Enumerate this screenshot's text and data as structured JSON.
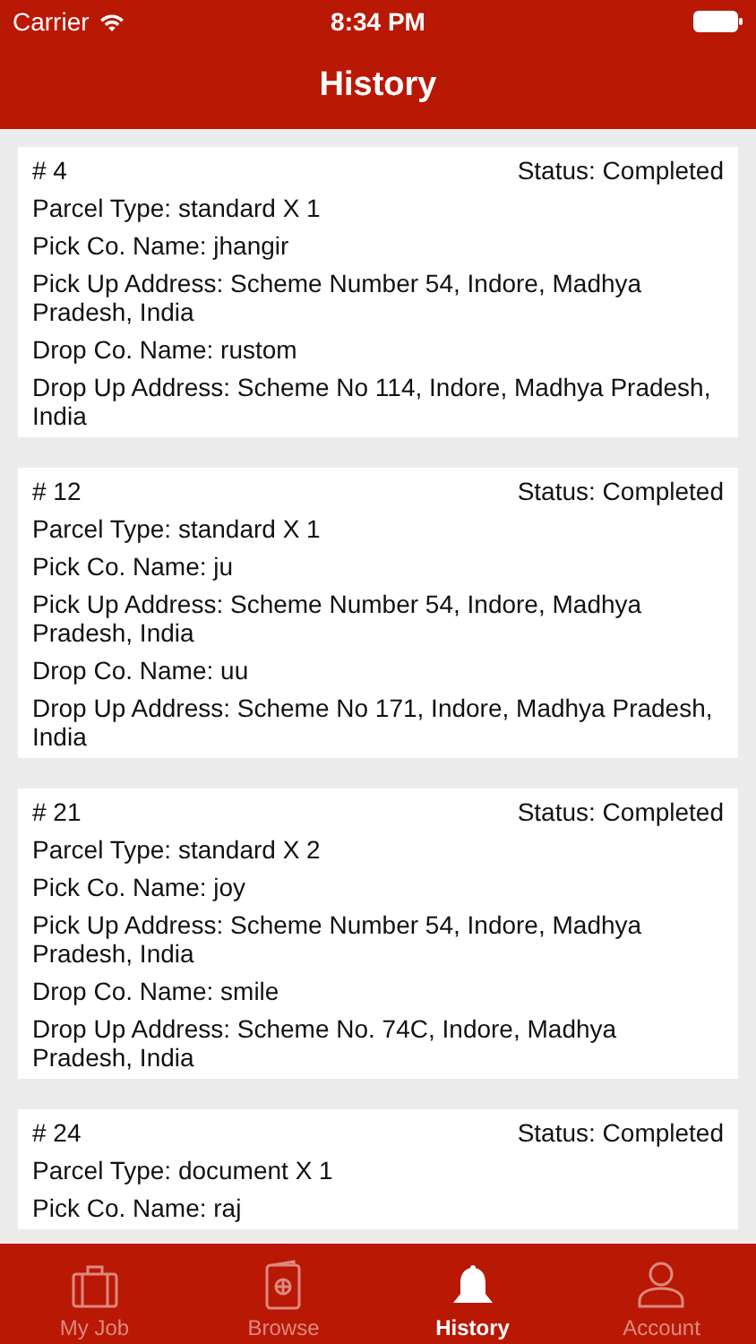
{
  "status_bar": {
    "carrier": "Carrier",
    "time": "8:34 PM"
  },
  "nav": {
    "title": "History"
  },
  "orders": [
    {
      "number": "# 4",
      "status": "Status: Completed",
      "lines": [
        "Parcel Type: standard X 1",
        "Pick Co. Name: jhangir",
        "Pick Up Address: Scheme Number 54, Indore, Madhya Pradesh, India",
        "Drop Co. Name: rustom",
        "Drop Up Address: Scheme No 114, Indore, Madhya Pradesh, India"
      ]
    },
    {
      "number": "# 12",
      "status": "Status: Completed",
      "lines": [
        "Parcel Type: standard X 1",
        "Pick Co. Name: ju",
        "Pick Up Address: Scheme Number 54, Indore, Madhya Pradesh, India",
        "Drop Co. Name: uu",
        "Drop Up Address: Scheme No 171, Indore, Madhya Pradesh, India"
      ]
    },
    {
      "number": "# 21",
      "status": "Status: Completed",
      "lines": [
        "Parcel Type: standard X 2",
        "Pick Co. Name: joy",
        "Pick Up Address: Scheme Number 54, Indore, Madhya Pradesh, India",
        "Drop Co. Name: smile",
        "Drop Up Address: Scheme No. 74C, Indore, Madhya Pradesh, India"
      ]
    },
    {
      "number": "# 24",
      "status": "Status: Completed",
      "lines": [
        "Parcel Type: document X 1",
        "Pick Co. Name: raj"
      ]
    }
  ],
  "tabs": [
    {
      "kind": "job",
      "label": "My Job",
      "selected": false
    },
    {
      "kind": "browse",
      "label": "Browse",
      "selected": false
    },
    {
      "kind": "history",
      "label": "History",
      "selected": true
    },
    {
      "kind": "account",
      "label": "Account",
      "selected": false
    }
  ]
}
